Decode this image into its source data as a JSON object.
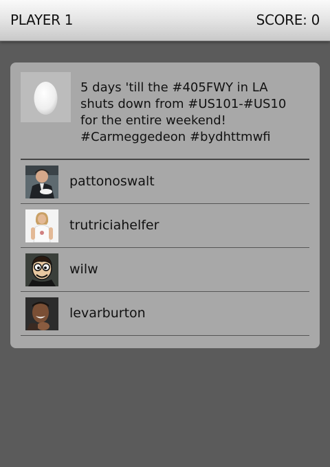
{
  "header": {
    "player_label": "PLAYER 1",
    "score_label": "SCORE: 0"
  },
  "tweet": {
    "avatar_icon": "egg-avatar-icon",
    "lines": [
      "5 days 'till the #405FWY in LA",
      "shuts down from #US101-#US10",
      "for the entire weekend!",
      "#Carmeggedeon #bydhttmwfi"
    ]
  },
  "choices": [
    {
      "handle": "pattonoswalt",
      "avatar_icon": "man-in-suit-avatar-icon"
    },
    {
      "handle": "trutriciahelfer",
      "avatar_icon": "woman-in-white-avatar-icon"
    },
    {
      "handle": "wilw",
      "avatar_icon": "cartoon-man-avatar-icon"
    },
    {
      "handle": "levarburton",
      "avatar_icon": "smiling-man-avatar-icon"
    }
  ],
  "colors": {
    "background": "#5b5b5b",
    "card": "#a8a8a8",
    "text": "#111111"
  }
}
